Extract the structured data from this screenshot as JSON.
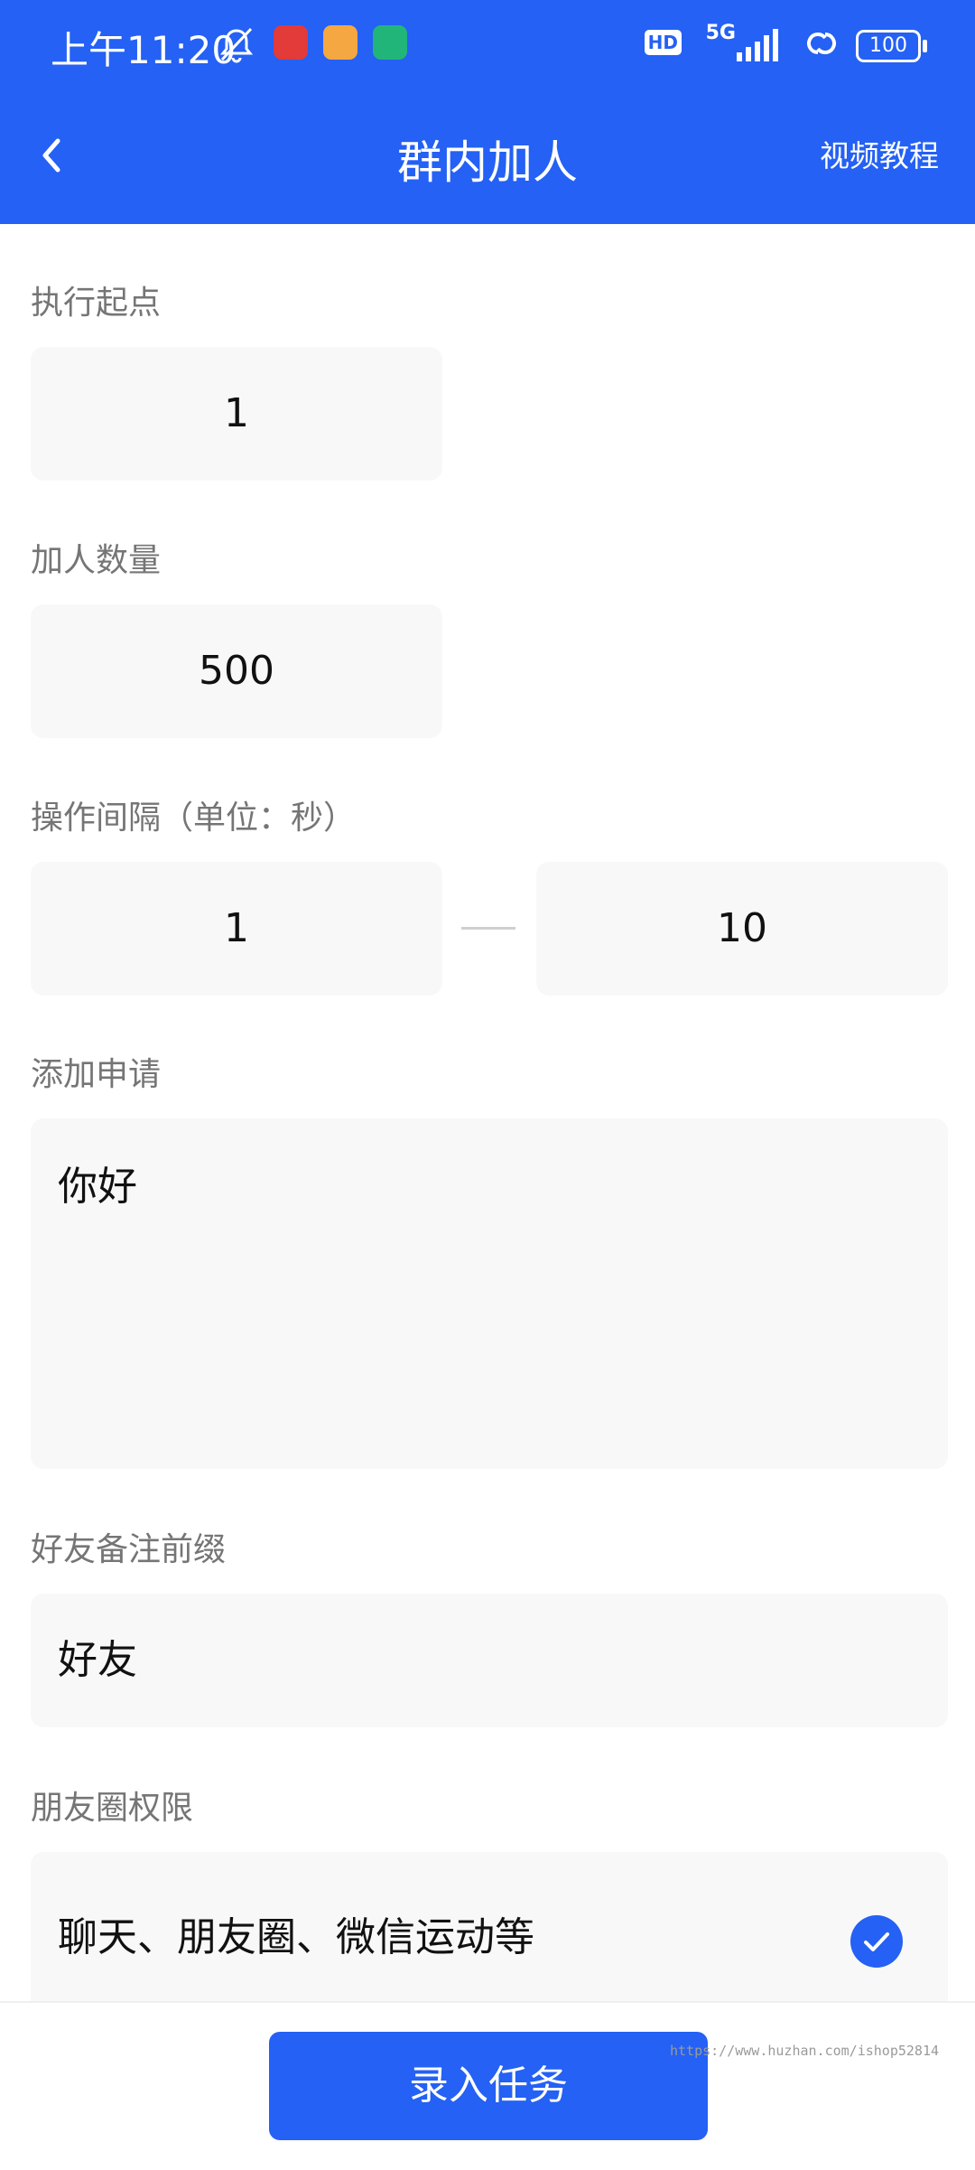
{
  "status_bar": {
    "time": "上午11:20",
    "network": "5G",
    "hd": "HD",
    "battery": "100"
  },
  "nav": {
    "title": "群内加人",
    "right_link": "视频教程"
  },
  "form": {
    "start_point": {
      "label": "执行起点",
      "value": "1"
    },
    "add_count": {
      "label": "加人数量",
      "value": "500"
    },
    "interval": {
      "label": "操作间隔（单位：秒）",
      "min": "1",
      "max": "10"
    },
    "request": {
      "label": "添加申请",
      "value": "你好"
    },
    "remark_prefix": {
      "label": "好友备注前缀",
      "value": "好友"
    },
    "moments_permission": {
      "label": "朋友圈权限",
      "option": "聊天、朋友圈、微信运动等",
      "checked": true
    }
  },
  "footer": {
    "submit_label": "录入任务",
    "watermark": "https://www.huzhan.com/ishop52814"
  },
  "colors": {
    "primary": "#2461f4",
    "field_bg": "#f8f8f8",
    "label": "#757575"
  }
}
